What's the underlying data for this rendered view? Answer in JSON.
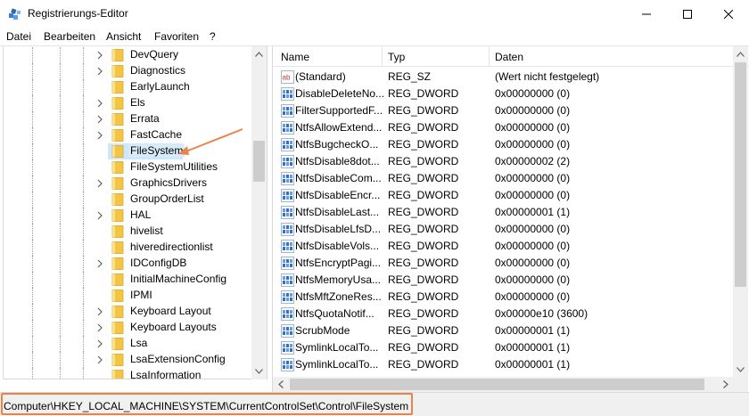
{
  "window": {
    "title": "Registrierungs-Editor",
    "controls": [
      "minimize",
      "maximize",
      "close"
    ]
  },
  "menu": {
    "items": [
      "Datei",
      "Bearbeiten",
      "Ansicht",
      "Favoriten",
      "?"
    ]
  },
  "tree": {
    "items": [
      {
        "label": "DevQuery",
        "expandable": true
      },
      {
        "label": "Diagnostics",
        "expandable": true
      },
      {
        "label": "EarlyLaunch",
        "expandable": false
      },
      {
        "label": "Els",
        "expandable": true
      },
      {
        "label": "Errata",
        "expandable": true
      },
      {
        "label": "FastCache",
        "expandable": true
      },
      {
        "label": "FileSystem",
        "expandable": false,
        "selected": true
      },
      {
        "label": "FileSystemUtilities",
        "expandable": false
      },
      {
        "label": "GraphicsDrivers",
        "expandable": true
      },
      {
        "label": "GroupOrderList",
        "expandable": false
      },
      {
        "label": "HAL",
        "expandable": true
      },
      {
        "label": "hivelist",
        "expandable": false
      },
      {
        "label": "hiveredirectionlist",
        "expandable": false
      },
      {
        "label": "IDConfigDB",
        "expandable": true
      },
      {
        "label": "InitialMachineConfig",
        "expandable": false
      },
      {
        "label": "IPMI",
        "expandable": false
      },
      {
        "label": "Keyboard Layout",
        "expandable": true
      },
      {
        "label": "Keyboard Layouts",
        "expandable": true
      },
      {
        "label": "Lsa",
        "expandable": true
      },
      {
        "label": "LsaExtensionConfig",
        "expandable": true
      },
      {
        "label": "LsaInformation",
        "expandable": false
      }
    ]
  },
  "list": {
    "columns": [
      "Name",
      "Typ",
      "Daten"
    ],
    "rows": [
      {
        "icon": "string-value-icon",
        "name": "(Standard)",
        "type": "REG_SZ",
        "data": "(Wert nicht festgelegt)"
      },
      {
        "icon": "binary-value-icon",
        "name": "DisableDeleteNo...",
        "type": "REG_DWORD",
        "data": "0x00000000 (0)"
      },
      {
        "icon": "binary-value-icon",
        "name": "FilterSupportedF...",
        "type": "REG_DWORD",
        "data": "0x00000000 (0)"
      },
      {
        "icon": "binary-value-icon",
        "name": "NtfsAllowExtend...",
        "type": "REG_DWORD",
        "data": "0x00000000 (0)"
      },
      {
        "icon": "binary-value-icon",
        "name": "NtfsBugcheckO...",
        "type": "REG_DWORD",
        "data": "0x00000000 (0)"
      },
      {
        "icon": "binary-value-icon",
        "name": "NtfsDisable8dot...",
        "type": "REG_DWORD",
        "data": "0x00000002 (2)"
      },
      {
        "icon": "binary-value-icon",
        "name": "NtfsDisableCom...",
        "type": "REG_DWORD",
        "data": "0x00000000 (0)"
      },
      {
        "icon": "binary-value-icon",
        "name": "NtfsDisableEncr...",
        "type": "REG_DWORD",
        "data": "0x00000000 (0)"
      },
      {
        "icon": "binary-value-icon",
        "name": "NtfsDisableLast...",
        "type": "REG_DWORD",
        "data": "0x00000001 (1)"
      },
      {
        "icon": "binary-value-icon",
        "name": "NtfsDisableLfsD...",
        "type": "REG_DWORD",
        "data": "0x00000000 (0)"
      },
      {
        "icon": "binary-value-icon",
        "name": "NtfsDisableVols...",
        "type": "REG_DWORD",
        "data": "0x00000000 (0)"
      },
      {
        "icon": "binary-value-icon",
        "name": "NtfsEncryptPagi...",
        "type": "REG_DWORD",
        "data": "0x00000000 (0)"
      },
      {
        "icon": "binary-value-icon",
        "name": "NtfsMemoryUsa...",
        "type": "REG_DWORD",
        "data": "0x00000000 (0)"
      },
      {
        "icon": "binary-value-icon",
        "name": "NtfsMftZoneRes...",
        "type": "REG_DWORD",
        "data": "0x00000000 (0)"
      },
      {
        "icon": "binary-value-icon",
        "name": "NtfsQuotaNotif...",
        "type": "REG_DWORD",
        "data": "0x00000e10 (3600)"
      },
      {
        "icon": "binary-value-icon",
        "name": "ScrubMode",
        "type": "REG_DWORD",
        "data": "0x00000001 (1)"
      },
      {
        "icon": "binary-value-icon",
        "name": "SymlinkLocalTo...",
        "type": "REG_DWORD",
        "data": "0x00000001 (1)"
      },
      {
        "icon": "binary-value-icon",
        "name": "SymlinkLocalTo...",
        "type": "REG_DWORD",
        "data": "0x00000001 (1)"
      }
    ]
  },
  "status": {
    "path": "Computer\\HKEY_LOCAL_MACHINE\\SYSTEM\\CurrentControlSet\\Control\\FileSystem"
  },
  "colors": {
    "annotation": "#e8844a",
    "selection": "#cce8ff",
    "folder": "#f4c542"
  }
}
